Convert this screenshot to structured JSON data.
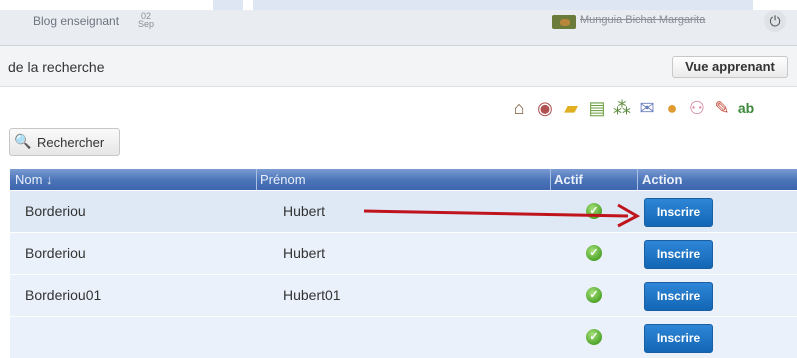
{
  "header": {
    "blog_link": "Blog enseignant",
    "date_day": "02",
    "date_month": "Sep",
    "user_name": "Munguia Bichat Margarita"
  },
  "subheader": {
    "title": "de la recherche",
    "view_button": "Vue apprenant"
  },
  "toolbar": {
    "icons": [
      "home-icon",
      "disc-icon",
      "folder-icon",
      "notes-icon",
      "network-icon",
      "mail-icon",
      "user-icon",
      "users-icon",
      "pencil-icon",
      "spellcheck-icon"
    ]
  },
  "search": {
    "button_label": "Rechercher"
  },
  "table": {
    "columns": [
      "Nom ↓",
      "Prénom",
      "Actif",
      "Action"
    ],
    "rows": [
      {
        "nom": "Borderiou",
        "prenom": "Hubert",
        "actif": true,
        "action": "Inscrire"
      },
      {
        "nom": "Borderiou",
        "prenom": "Hubert",
        "actif": true,
        "action": "Inscrire"
      },
      {
        "nom": "Borderiou01",
        "prenom": "Hubert01",
        "actif": true,
        "action": "Inscrire"
      },
      {
        "nom": "",
        "prenom": "",
        "actif": true,
        "action": "Inscrire"
      }
    ]
  },
  "colors": {
    "header_bar": "#e9ecf0",
    "table_header": "#4a73b8",
    "row_bg": "#eaf1fa",
    "button": "#1466b6",
    "arrow": "#c0141c",
    "check": "#4fa52b"
  }
}
